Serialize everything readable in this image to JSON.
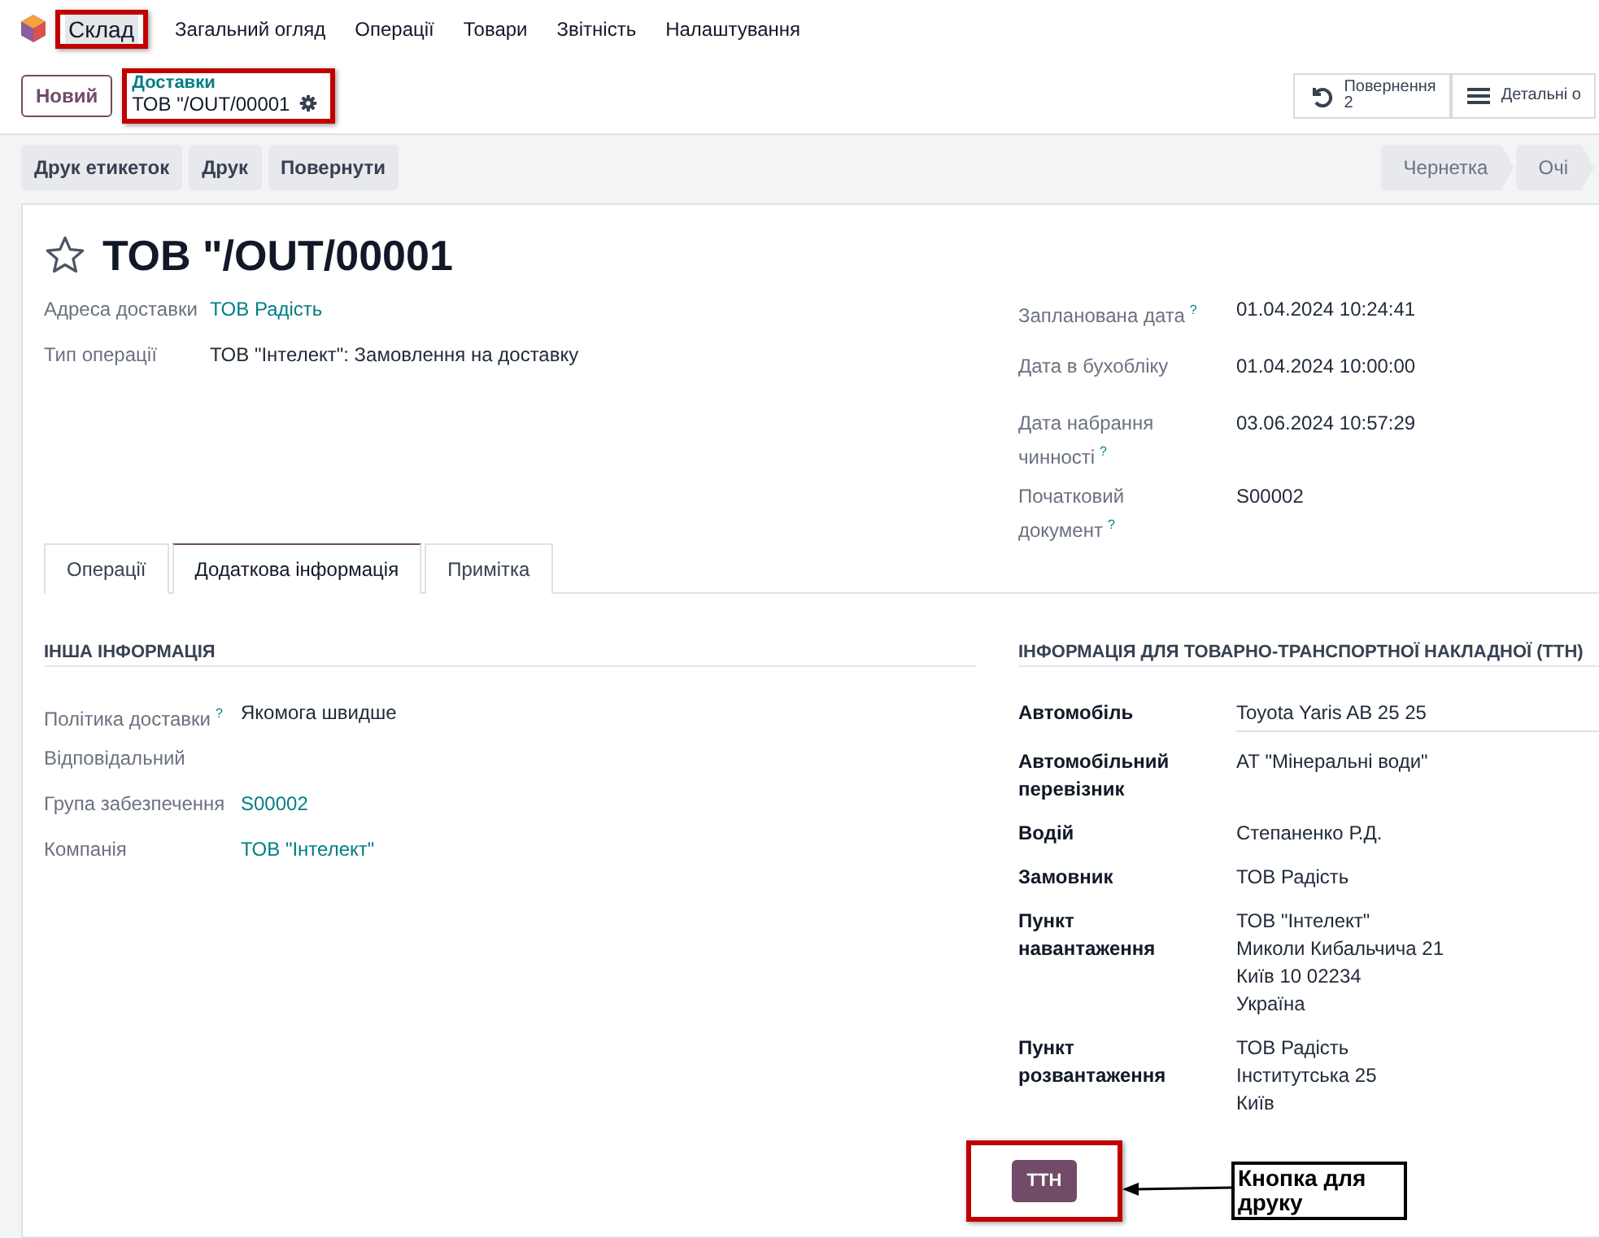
{
  "nav": {
    "app_name": "Склад",
    "app_highlighted": true,
    "items": [
      "Загальний огляд",
      "Операції",
      "Товари",
      "Звітність",
      "Налаштування"
    ]
  },
  "control": {
    "new_button": "Новий",
    "breadcrumb": "Доставки",
    "record": "ТОВ \"/OUT/00001",
    "breadcrumb_highlighted": true,
    "smart_buttons": [
      {
        "kind": "return",
        "label": "Повернення",
        "count": "2"
      },
      {
        "kind": "details",
        "label": "Детальні о"
      }
    ]
  },
  "actions": [
    "Друк етикеток",
    "Друк",
    "Повернути"
  ],
  "statusbar": [
    "Чернетка",
    "Очі"
  ],
  "record": {
    "title": "ТОВ \"/OUT/00001",
    "starred": false
  },
  "left_fields": [
    {
      "label": "Адреса доставки",
      "kind": "link",
      "lines": [
        "ТОВ Радість"
      ]
    },
    {
      "label": "Тип операції",
      "kind": "text",
      "lines": [
        "ТОВ \"Інтелект\": Замовлення на доставку"
      ]
    }
  ],
  "right_fields": [
    {
      "label": "Запланована дата",
      "help": "?",
      "kind": "text",
      "lines": [
        "01.04.2024 10:24:41"
      ]
    },
    {
      "label": "Дата в бухобліку",
      "kind": "text",
      "lines": [
        "01.04.2024 10:00:00"
      ]
    },
    {
      "label": "Дата набрання чинності",
      "help": "?",
      "kind": "text",
      "lines": [
        "03.06.2024 10:57:29"
      ]
    },
    {
      "label": "Початковий документ",
      "help": "?",
      "kind": "text",
      "lines": [
        "S00002"
      ]
    }
  ],
  "tabs": [
    {
      "label": "Операції",
      "selected": false
    },
    {
      "label": "Додаткова інформація",
      "selected": true
    },
    {
      "label": "Примітка",
      "selected": false
    }
  ],
  "other_info": {
    "title": "ІНША ІНФОРМАЦІЯ",
    "fields": [
      {
        "label": "Політика доставки",
        "help": "?",
        "kind": "text",
        "lines": [
          "Якомога швидше"
        ]
      },
      {
        "label": "Відповідальний"
      },
      {
        "label": "Група забезпечення",
        "kind": "link",
        "lines": [
          "S00002"
        ]
      },
      {
        "label": "Компанія",
        "kind": "link",
        "lines": [
          "ТОВ \"Інтелект\""
        ]
      }
    ]
  },
  "ttn_info": {
    "title": "ІНФОРМАЦІЯ ДЛЯ ТОВАРНО-ТРАНСПОРТНОЇ НАКЛАДНОЇ (ТТН)",
    "fields": [
      {
        "label": "Автомобіль",
        "kind": "input",
        "lines": [
          "Toyota Yaris AB 25 25"
        ]
      },
      {
        "label": "Автомобільний перевізник",
        "kind": "text",
        "lines": [
          "АТ \"Мінеральні води\""
        ]
      },
      {
        "label": "Водій",
        "kind": "text",
        "lines": [
          "Степаненко Р.Д."
        ]
      },
      {
        "label": "Замовник",
        "kind": "text",
        "lines": [
          "ТОВ Радість"
        ]
      },
      {
        "label": "Пункт навантаження",
        "kind": "text",
        "lines": [
          "ТОВ \"Інтелект\"",
          "Миколи Кибальчича 21",
          "Київ 10 02234",
          "Україна"
        ]
      },
      {
        "label": "Пункт розвантаження",
        "kind": "text",
        "lines": [
          "ТОВ Радість",
          "Інститутська 25",
          "Київ"
        ]
      }
    ],
    "button": "ТТН",
    "button_highlighted": true
  },
  "callout": {
    "text": "Кнопка для друку"
  }
}
